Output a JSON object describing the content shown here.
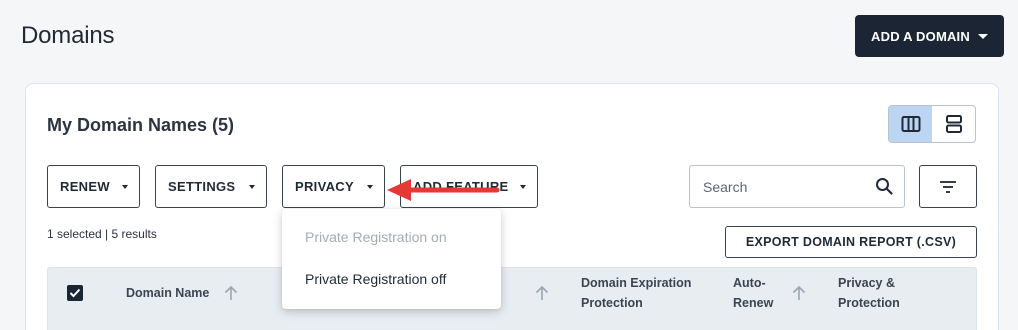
{
  "header": {
    "title": "Domains",
    "add_domain_label": "ADD A DOMAIN"
  },
  "card": {
    "title": "My Domain Names (5)",
    "view_modes": [
      "column-view-icon",
      "row-view-icon"
    ],
    "active_view": "column-view-icon"
  },
  "toolbar": {
    "renew_label": "RENEW",
    "settings_label": "SETTINGS",
    "privacy_label": "PRIVACY",
    "add_feature_label": "ADD FEATURE",
    "search_placeholder": "Search",
    "filter_icon": "filter-icon"
  },
  "selection": {
    "info": "1 selected | 5 results"
  },
  "export": {
    "label": "EXPORT DOMAIN REPORT (.CSV)"
  },
  "table": {
    "columns": [
      {
        "label": "Domain Name",
        "sortable": true
      },
      {
        "label": "",
        "sortable": true
      },
      {
        "label": "Domain Expiration Protection",
        "sortable": false
      },
      {
        "label": "Auto-Renew",
        "sortable": true
      },
      {
        "label": "Privacy & Protection",
        "sortable": false
      }
    ],
    "col_domain_name": "Domain Name",
    "col_expiration_line1": "Domain Expiration",
    "col_expiration_line2": "Protection",
    "col_autorenew_line1": "Auto-",
    "col_autorenew_line2": "Renew",
    "col_privacy_line1": "Privacy &",
    "col_privacy_line2": "Protection",
    "select_all_checked": true
  },
  "privacy_dropdown": {
    "items": [
      {
        "label": "Private Registration on",
        "disabled": true
      },
      {
        "label": "Private Registration off",
        "disabled": false
      }
    ]
  },
  "colors": {
    "primary_dark": "#1b2533",
    "active_toggle": "#bcd5f2",
    "annotation_arrow": "#e53935",
    "table_header_bg": "#e8edf2"
  }
}
